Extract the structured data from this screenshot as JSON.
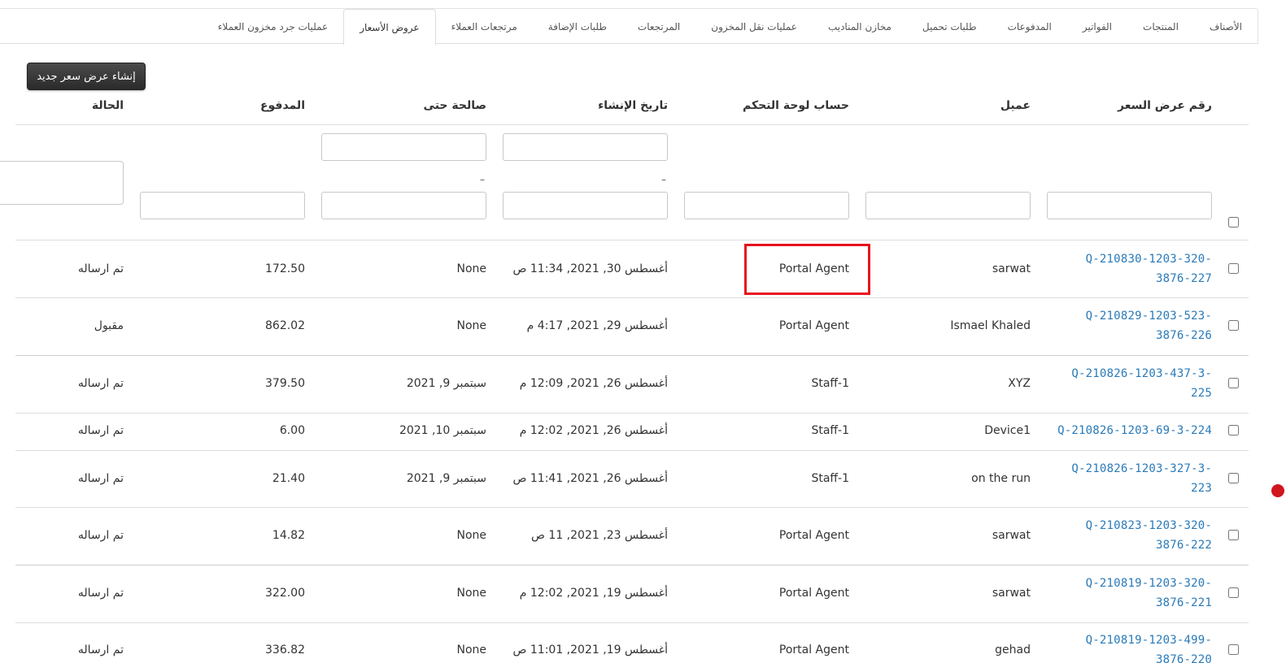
{
  "tabs": [
    {
      "label": "الأصناف",
      "active": false
    },
    {
      "label": "المنتجات",
      "active": false
    },
    {
      "label": "الفواتير",
      "active": false
    },
    {
      "label": "المدفوعات",
      "active": false
    },
    {
      "label": "طلبات تحميل",
      "active": false
    },
    {
      "label": "مخازن المناديب",
      "active": false
    },
    {
      "label": "عمليات نقل المخزون",
      "active": false
    },
    {
      "label": "المرتجعات",
      "active": false
    },
    {
      "label": "طلبات الإضافة",
      "active": false
    },
    {
      "label": "مرتجعات العملاء",
      "active": false
    },
    {
      "label": "عروض الأسعار",
      "active": true
    },
    {
      "label": "عمليات جرد مخزون العملاء",
      "active": false
    }
  ],
  "toolbar": {
    "create_label": "إنشاء عرض سعر جديد"
  },
  "columns": {
    "quote_no": "رقم عرض السعر",
    "customer": "عميل",
    "dashboard_account": "حساب لوحة التحكم",
    "created_at": "تاريخ الإنشاء",
    "valid_until": "صالحة حتى",
    "paid": "المدفوع",
    "status": "الحالة"
  },
  "filters": {
    "range_separator": "–"
  },
  "rows": [
    {
      "quote_l1": "Q-210830-1203-320-",
      "quote_l2": "3876-227",
      "customer": "sarwat",
      "account": "Portal Agent",
      "created": "أغسطس 30, 2021, 11:34 ص",
      "valid": "None",
      "paid": "172.50",
      "status": "تم ارساله"
    },
    {
      "quote_l1": "Q-210829-1203-523-",
      "quote_l2": "3876-226",
      "customer": "Ismael Khaled",
      "account": "Portal Agent",
      "created": "أغسطس 29, 2021, 4:17 م",
      "valid": "None",
      "paid": "862.02",
      "status": "مقبول"
    },
    {
      "quote_l1": "Q-210826-1203-437-3-",
      "quote_l2": "225",
      "customer": "XYZ",
      "account": "Staff-1",
      "created": "أغسطس 26, 2021, 12:09 م",
      "valid": "سبتمبر 9, 2021",
      "paid": "379.50",
      "status": "تم ارساله"
    },
    {
      "quote_l1": "Q-210826-1203-69-3-224",
      "quote_l2": "",
      "customer": "Device1",
      "account": "Staff-1",
      "created": "أغسطس 26, 2021, 12:02 م",
      "valid": "سبتمبر 10, 2021",
      "paid": "6.00",
      "status": "تم ارساله"
    },
    {
      "quote_l1": "Q-210826-1203-327-3-",
      "quote_l2": "223",
      "customer": "on the run",
      "account": "Staff-1",
      "created": "أغسطس 26, 2021, 11:41 ص",
      "valid": "سبتمبر 9, 2021",
      "paid": "21.40",
      "status": "تم ارساله"
    },
    {
      "quote_l1": "Q-210823-1203-320-",
      "quote_l2": "3876-222",
      "customer": "sarwat",
      "account": "Portal Agent",
      "created": "أغسطس 23, 2021, 11 ص",
      "valid": "None",
      "paid": "14.82",
      "status": "تم ارساله"
    },
    {
      "quote_l1": "Q-210819-1203-320-",
      "quote_l2": "3876-221",
      "customer": "sarwat",
      "account": "Portal Agent",
      "created": "أغسطس 19, 2021, 12:02 م",
      "valid": "None",
      "paid": "322.00",
      "status": "تم ارساله"
    },
    {
      "quote_l1": "Q-210819-1203-499-",
      "quote_l2": "3876-220",
      "customer": "gehad",
      "account": "Portal Agent",
      "created": "أغسطس 19, 2021, 11:01 ص",
      "valid": "None",
      "paid": "336.82",
      "status": "تم ارساله"
    }
  ]
}
